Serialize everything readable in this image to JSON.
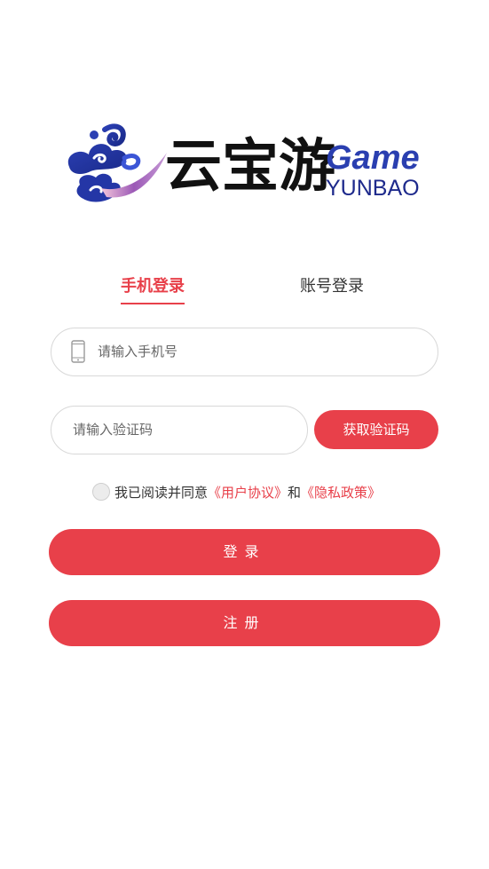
{
  "logo": {
    "cn": "云宝游",
    "en_top": "Game",
    "en_bottom": "YUNBAO"
  },
  "tabs": [
    {
      "label": "手机登录",
      "active": true
    },
    {
      "label": "账号登录",
      "active": false
    }
  ],
  "phone": {
    "placeholder": "请输入手机号",
    "value": "",
    "icon": "mobile-phone-icon"
  },
  "code": {
    "placeholder": "请输入验证码",
    "value": "",
    "button_label": "获取验证码"
  },
  "agreement": {
    "checked": false,
    "prefix": "我已阅读并同意",
    "user_agreement": "《用户协议》",
    "conjunction": "和",
    "privacy_policy": "《隐私政策》"
  },
  "buttons": {
    "login": "登录",
    "register": "注册"
  },
  "colors": {
    "accent": "#e8404a",
    "logo_blue": "#2a3fb0",
    "border": "#d8d8d8"
  }
}
